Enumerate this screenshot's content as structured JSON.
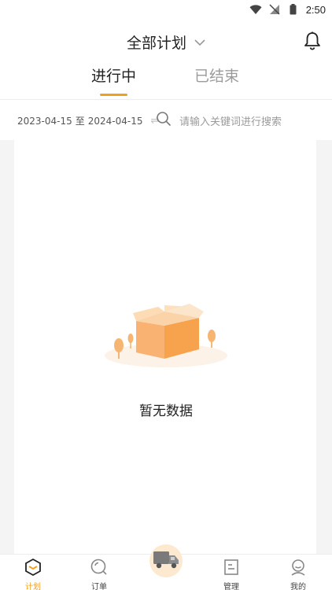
{
  "status_bar": {
    "time": "2:50"
  },
  "header": {
    "title": "全部计划"
  },
  "tabs": [
    {
      "label": "进行中",
      "active": true
    },
    {
      "label": "已结束",
      "active": false
    }
  ],
  "filter": {
    "date_start": "2023-04-15",
    "date_separator": "至",
    "date_end": "2024-04-15",
    "search_placeholder": "请输入关键词进行搜索"
  },
  "empty_state": {
    "text": "暂无数据"
  },
  "bottom_nav": {
    "items": [
      {
        "label": "计划",
        "icon": "plan-icon",
        "active": true
      },
      {
        "label": "订单",
        "icon": "order-icon",
        "active": false
      },
      {
        "label": "",
        "icon": "truck-icon",
        "active": false
      },
      {
        "label": "管理",
        "icon": "manage-icon",
        "active": false
      },
      {
        "label": "我的",
        "icon": "profile-icon",
        "active": false
      }
    ]
  },
  "colors": {
    "accent": "#f0a020",
    "background": "#f4f4f4",
    "box_orange": "#f7b572"
  }
}
